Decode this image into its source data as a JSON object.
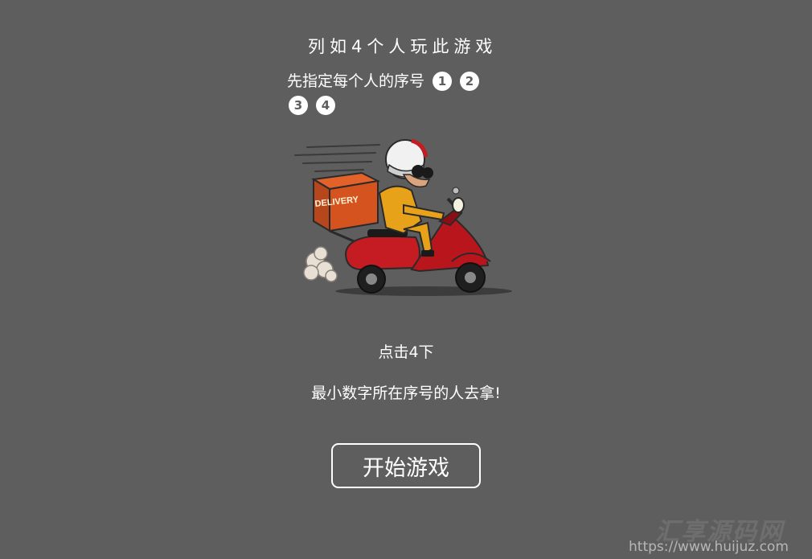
{
  "intro": {
    "heading": "列如4个人玩此游戏",
    "assign_text": "先指定每个人的序号",
    "numbers": [
      "1",
      "2",
      "3",
      "4"
    ]
  },
  "illustration": {
    "box_text": "DELIVERY"
  },
  "instructions": {
    "tap": "点击4下",
    "rule": "最小数字所在序号的人去拿!"
  },
  "start_button": {
    "label": "开始游戏"
  },
  "watermark": {
    "logo_text": "汇享源码网",
    "url": "https://www.huijuz.com"
  }
}
